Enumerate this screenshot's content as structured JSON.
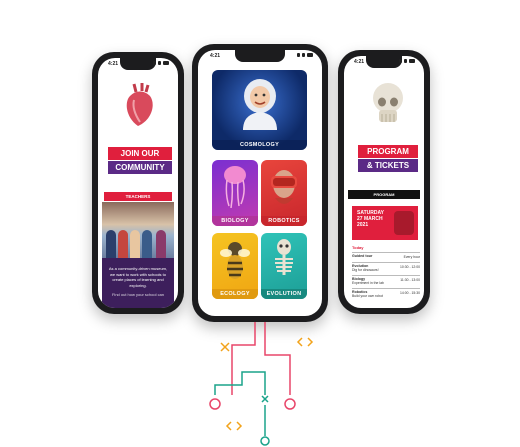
{
  "left_phone": {
    "time": "4:21",
    "join_line1": "JOIN OUR",
    "join_line2": "COMMUNITY",
    "teachers": "TEACHERS",
    "body_text": "As a community-driven museum, we want to work with schools to create places of learning and exploring.",
    "body_tail": "Find out how your school can"
  },
  "center_phone": {
    "time": "4:21",
    "tiles": {
      "cosmology": "COSMOLOGY",
      "biology": "BIOLOGY",
      "robotics": "ROBOTICS",
      "ecology": "ECOLOGY",
      "evolution": "EVOLUTION"
    }
  },
  "right_phone": {
    "time": "4:21",
    "title_line1": "PROGRAM",
    "title_line2": "& TICKETS",
    "program_bar": "PROGRAM",
    "date_line1": "SATURDAY",
    "date_line2": "27 MARCH",
    "date_line3": "2021",
    "today": "Today",
    "events": [
      {
        "name": "Guided tour",
        "sub": "",
        "time": "Every hour"
      },
      {
        "name": "Evolution",
        "sub": "Dig for dinosaurs!",
        "time": "10:30 - 12:00"
      },
      {
        "name": "Biology",
        "sub": "Experiment in the lab",
        "time": "11:30 - 13:00"
      },
      {
        "name": "Robotics",
        "sub": "Build your own robot",
        "time": "14:00 - 15:30"
      }
    ]
  },
  "colors": {
    "accent_red": "#e01f3d",
    "accent_purple": "#5b2a86",
    "circuit_pink": "#e8466a",
    "circuit_green": "#1aa38a",
    "circuit_orange": "#f2a31b"
  },
  "icons": [
    "code-brackets-icon",
    "cross-icon"
  ]
}
